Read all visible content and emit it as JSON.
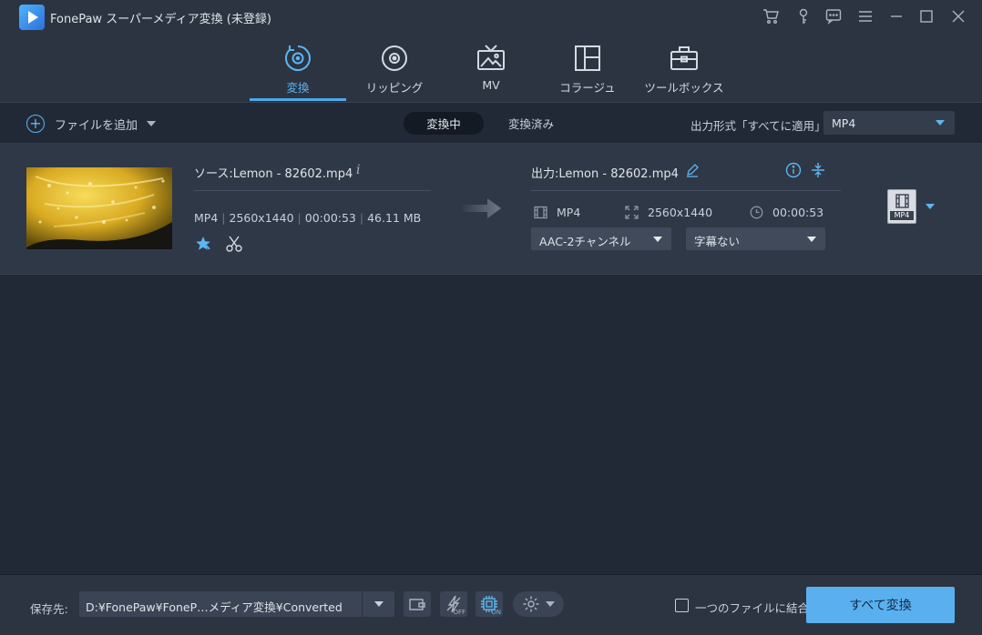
{
  "window": {
    "title": "FonePaw スーパーメディア変換 (未登録)"
  },
  "nav": {
    "tabs": [
      {
        "label": "変換",
        "icon": "convert-icon",
        "active": true
      },
      {
        "label": "リッピング",
        "icon": "disc-icon",
        "active": false
      },
      {
        "label": "MV",
        "icon": "tv-icon",
        "active": false
      },
      {
        "label": "コラージュ",
        "icon": "collage-icon",
        "active": false
      },
      {
        "label": "ツールボックス",
        "icon": "toolbox-icon",
        "active": false
      }
    ]
  },
  "toolbar": {
    "add_file_label": "ファイルを追加",
    "segment_converting": "変換中",
    "segment_converted": "変換済み",
    "output_format_label": "出力形式「すべてに適用」:",
    "output_format_value": "MP4"
  },
  "file": {
    "source_name": "ソース:Lemon - 82602.mp4",
    "meta": [
      "MP4",
      "2560x1440",
      "00:00:53",
      "46.11 MB"
    ],
    "output_name": "出力:Lemon - 82602.mp4",
    "output_format": "MP4",
    "output_resolution": "2560x1440",
    "output_duration": "00:00:53",
    "audio_track": "AAC-2チャンネル",
    "subtitle": "字幕ない",
    "format_badge": "MP4"
  },
  "bottom": {
    "save_label": "保存先:",
    "save_path": "D:¥FonePaw¥FoneP…メディア変換¥Converted",
    "speed_badge": "OFF",
    "hw_badge": "ON",
    "merge_label": "一つのファイルに結合",
    "merge_checked": false,
    "convert_all_label": "すべて変換"
  },
  "colors": {
    "accent": "#5db6f2",
    "background": "#212936",
    "row_background": "#2f3847",
    "convert_button": "#5ab0ef"
  }
}
